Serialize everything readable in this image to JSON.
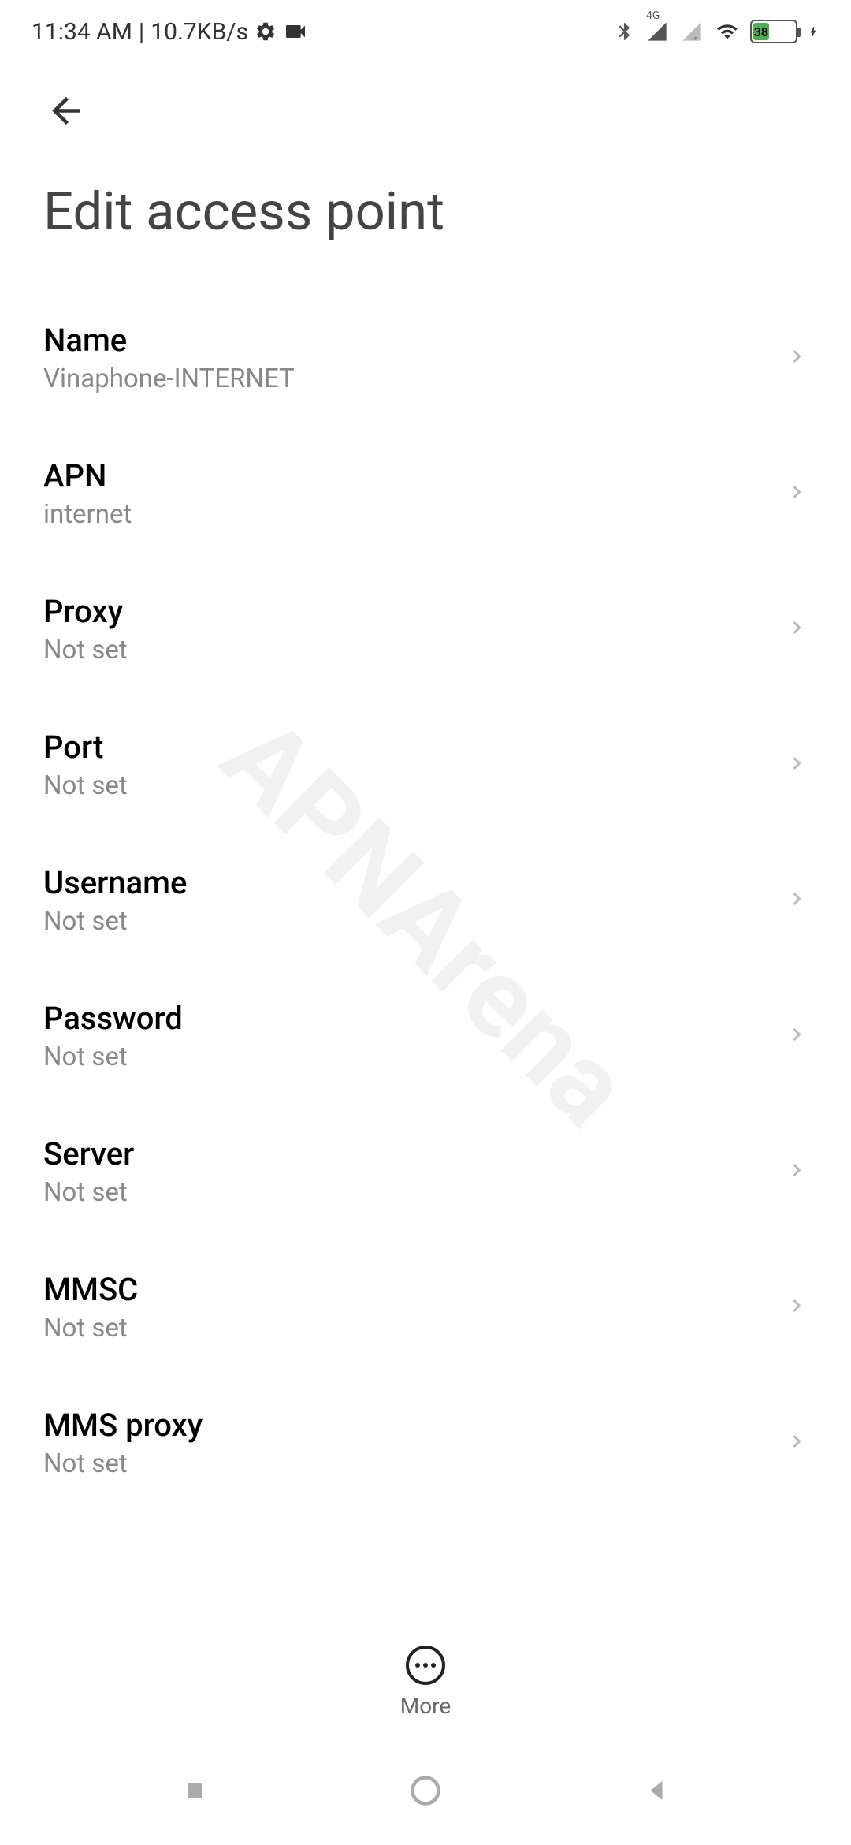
{
  "status": {
    "time": "11:34 AM",
    "separator": "|",
    "speed": "10.7KB/s",
    "battery": "38",
    "network_type": "4G"
  },
  "page_title": "Edit access point",
  "settings": [
    {
      "label": "Name",
      "value": "Vinaphone-INTERNET"
    },
    {
      "label": "APN",
      "value": "internet"
    },
    {
      "label": "Proxy",
      "value": "Not set"
    },
    {
      "label": "Port",
      "value": "Not set"
    },
    {
      "label": "Username",
      "value": "Not set"
    },
    {
      "label": "Password",
      "value": "Not set"
    },
    {
      "label": "Server",
      "value": "Not set"
    },
    {
      "label": "MMSC",
      "value": "Not set"
    },
    {
      "label": "MMS proxy",
      "value": "Not set"
    }
  ],
  "bottom_action": {
    "label": "More"
  },
  "watermark": "APNArena"
}
